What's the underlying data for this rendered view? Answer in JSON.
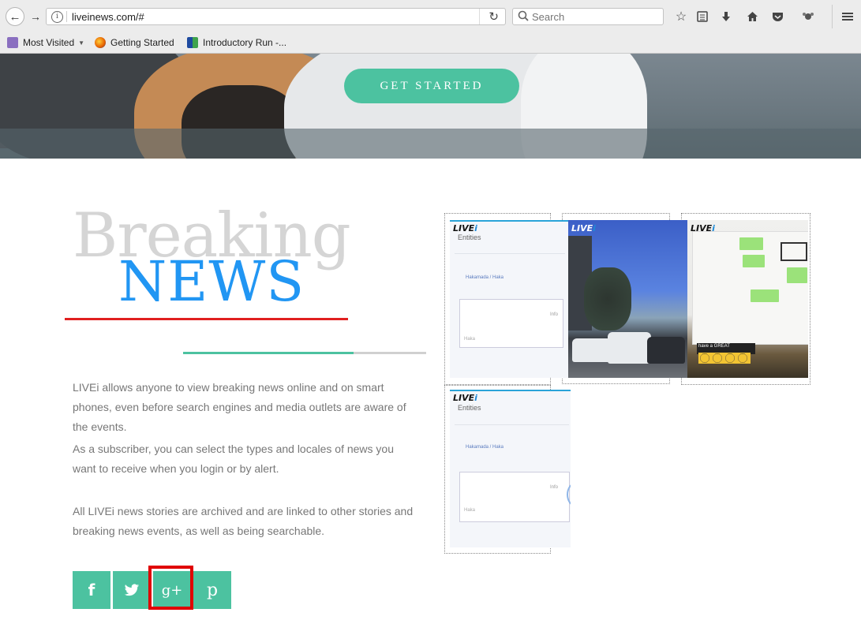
{
  "browser": {
    "url": "liveinews.com/#",
    "search_placeholder": "Search",
    "bookmarks": [
      {
        "label": "Most Visited",
        "icon": "folder-icon",
        "has_dropdown": true
      },
      {
        "label": "Getting Started",
        "icon": "firefox-icon"
      },
      {
        "label": "Introductory Run -...",
        "icon": "grid-icon"
      }
    ]
  },
  "hero": {
    "cta_label": "GET STARTED"
  },
  "section": {
    "title_top": "Breaking",
    "title_main": "NEWS",
    "paragraphs": [
      "LIVEi allows anyone to view breaking news online and on smart phones, even before search engines and media outlets are aware of the events.",
      "As a subscriber, you can select the types and locales of news you want to receive when you login or by alert.",
      "All LIVEi news stories are archived and are linked to other stories and breaking news events, as well as being searchable."
    ]
  },
  "collage": {
    "entities_label": "Entities",
    "crumb": "Hakamada / Haka",
    "info_label": "Info",
    "field_label": "Haka",
    "board_text": "have a GREAT"
  },
  "social": [
    {
      "name": "facebook",
      "glyph": "f"
    },
    {
      "name": "twitter",
      "glyph": "🐦"
    },
    {
      "name": "google-plus",
      "glyph": "g+"
    },
    {
      "name": "pinterest",
      "glyph": "p"
    }
  ],
  "colors": {
    "accent_green": "#4cc2a0",
    "news_blue": "#2196f3",
    "underline_red": "#e02020",
    "highlight_red": "#e00000"
  }
}
